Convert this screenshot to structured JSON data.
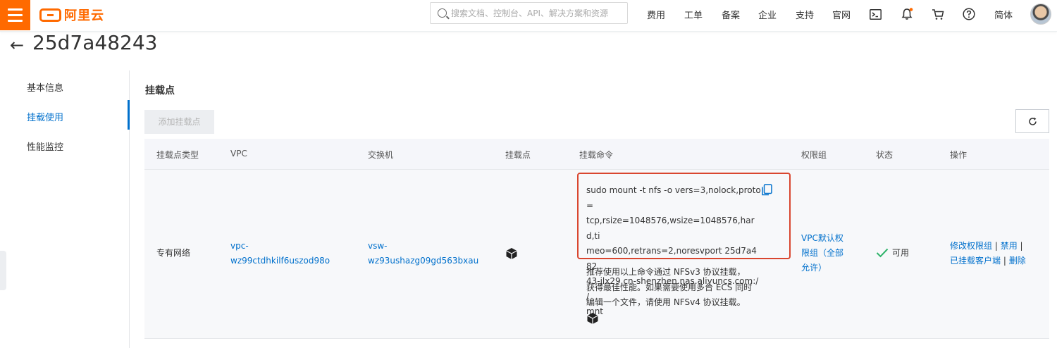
{
  "topbar": {
    "logo_text": "阿里云",
    "search_placeholder": "搜索文档、控制台、API、解决方案和资源",
    "nav": [
      "费用",
      "工单",
      "备案",
      "企业",
      "支持",
      "官网"
    ],
    "lang": "简体"
  },
  "page": {
    "title": "25d7a48243",
    "section_title": "挂载点",
    "add_button": "添加挂载点"
  },
  "sidebar": {
    "items": [
      {
        "label": "基本信息",
        "active": false
      },
      {
        "label": "挂载使用",
        "active": true
      },
      {
        "label": "性能监控",
        "active": false
      }
    ]
  },
  "table": {
    "headers": [
      "挂载点类型",
      "VPC",
      "交换机",
      "挂载点",
      "挂载命令",
      "权限组",
      "状态",
      "操作"
    ],
    "row": {
      "type": "专有网络",
      "vpc_line1": "vpc-",
      "vpc_line2": "wz99ctdhkilf6uszod98o",
      "vsw_line1": "vsw-",
      "vsw_line2": "wz93ushazg09gd563bxau",
      "command_lines": [
        "sudo mount -t nfs -o vers=3,nolock,proto=",
        "tcp,rsize=1048576,wsize=1048576,hard,ti",
        "meo=600,retrans=2,noresvport 25d7a482",
        "43-jlx29.cn-shenzhen.nas.aliyuncs.com:/ /",
        "mnt"
      ],
      "note_lines": [
        "推荐使用以上命令通过 NFSv3 协议挂载，",
        "获得最佳性能。如果需要使用多台 ECS 同时",
        "编辑一个文件，请使用 NFSv4 协议挂载。"
      ],
      "permission_lines": [
        "VPC默认权",
        "限组（全部",
        "允许）"
      ],
      "status": "可用",
      "actions": {
        "modify": "修改权限组",
        "disable": "禁用",
        "clients": "已挂载客户端",
        "delete": "删除"
      }
    }
  },
  "colors": {
    "brand": "#ff6a00",
    "link": "#0070cc",
    "highlight_border": "#d9462f",
    "ok": "#2fb36a"
  }
}
